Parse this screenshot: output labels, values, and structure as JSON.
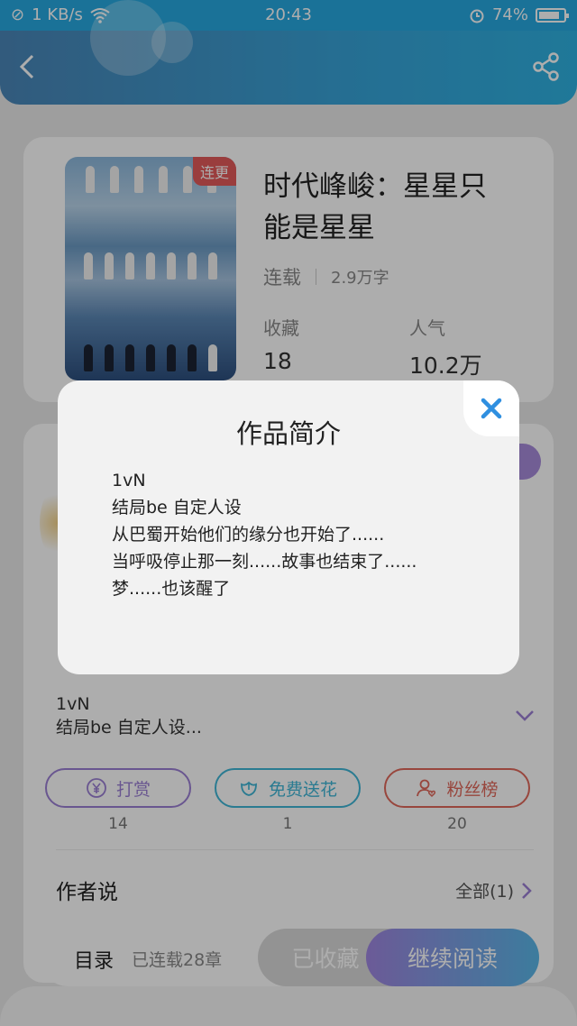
{
  "status_bar": {
    "speed": "1 KB/s",
    "time": "20:43",
    "battery": "74%"
  },
  "book": {
    "serial_tag": "连更",
    "title_line1": "时代峰峻：星星只",
    "title_line2": "能是星星",
    "status": "连载",
    "word_count": "2.9万字",
    "favorites_label": "收藏",
    "favorites_value": "18",
    "popularity_label": "人气",
    "popularity_value": "10.2万"
  },
  "intro": {
    "line1": "1vN",
    "line2": "结局be  自定人设..."
  },
  "actions": [
    {
      "label": "打赏",
      "count": "14",
      "color": "#9b7fd4"
    },
    {
      "label": "免费送花",
      "count": "1",
      "color": "#3fb5d6"
    },
    {
      "label": "粉丝榜",
      "count": "20",
      "color": "#e0675a"
    }
  ],
  "author_says": {
    "label": "作者说",
    "all_link": "全部(1)"
  },
  "bottom_bar": {
    "toc": "目录",
    "serial_count": "已连载28章",
    "collected": "已收藏",
    "continue_reading": "继续阅读"
  },
  "modal": {
    "title": "作品简介",
    "lines": [
      "1vN",
      "结局be  自定人设",
      "从巴蜀开始他们的缘分也开始了......",
      "当呼吸停止那一刻......故事也结束了......",
      "梦......也该醒了"
    ]
  },
  "colors": {
    "header": "#37a3d8",
    "accent_purple": "#9b7fd4",
    "accent_blue": "#3fb5d6",
    "accent_red": "#e0675a",
    "close_icon": "#2f8fe0"
  }
}
